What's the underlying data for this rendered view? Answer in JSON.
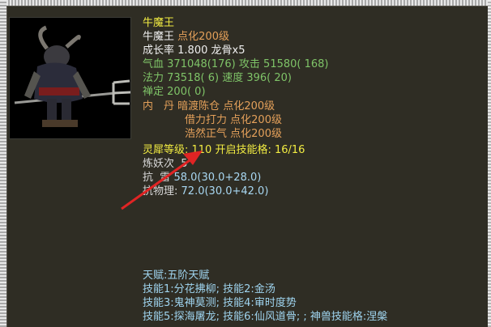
{
  "pet": {
    "name_title": "牛魔王",
    "name": "牛魔王",
    "name_tag": "点化200级",
    "growth_label": "成长率",
    "growth_value": "1.800 龙骨x5",
    "hp_label": "气血",
    "hp_value": "371048(176)",
    "atk_label": "攻击",
    "atk_value": "51580( 168)",
    "mp_label": "法力",
    "mp_value": "73518( 6)",
    "spd_label": "速度",
    "spd_value": "396( 20)",
    "zen_label": "禅定",
    "zen_value": "200( 0)",
    "inner_label": "内　丹",
    "inner1_name": "暗渡陈仓",
    "inner1_level": "点化200级",
    "inner2_name": "借力打力",
    "inner2_level": "点化200级",
    "inner3_name": "浩然正气",
    "inner3_level": "点化200级",
    "spirit_line": "灵犀等级: 110 开启技能格: 16/16",
    "refine_prefix": "炼妖次",
    "refine_suffix": "5",
    "resist1_label": "抗",
    "resist1_mid": "雷",
    "resist1_value": "58.0(30.0+28.0)",
    "resist2_label": "抗物理:",
    "resist2_value": "72.0(30.0+42.0)",
    "talent": "天赋:五阶天赋",
    "skills_row1": "技能1:分花拂柳; 技能2:金汤",
    "skills_row2": "技能3:鬼神莫测; 技能4:审时度势",
    "skills_row3": "技能5:探海屠龙; 技能6:仙风道骨; ; 神兽技能格:涅槃"
  },
  "colors": {
    "panel_bg": "#2f2d24",
    "arrow": "#e02424"
  },
  "icons": {
    "portrait": "bull-demon-king-portrait",
    "arrow": "red-annotation-arrow"
  }
}
